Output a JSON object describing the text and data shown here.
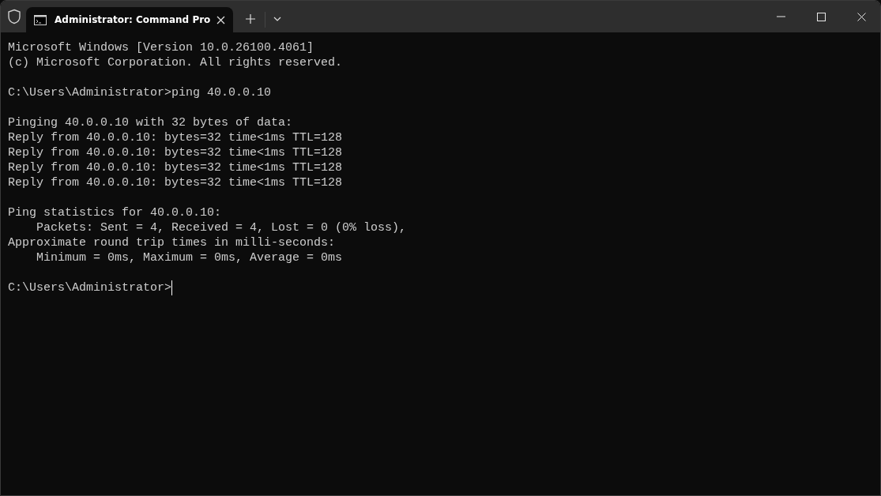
{
  "tabs": [
    {
      "title": "Administrator: Command Pro",
      "selected": true
    }
  ],
  "console": {
    "blocks": [
      [
        "Microsoft Windows [Version 10.0.26100.4061]",
        "(c) Microsoft Corporation. All rights reserved."
      ],
      [
        "C:\\Users\\Administrator>ping 40.0.0.10"
      ],
      [
        "Pinging 40.0.0.10 with 32 bytes of data:",
        "Reply from 40.0.0.10: bytes=32 time<1ms TTL=128",
        "Reply from 40.0.0.10: bytes=32 time<1ms TTL=128",
        "Reply from 40.0.0.10: bytes=32 time<1ms TTL=128",
        "Reply from 40.0.0.10: bytes=32 time<1ms TTL=128"
      ],
      [
        "Ping statistics for 40.0.0.10:",
        "    Packets: Sent = 4, Received = 4, Lost = 0 (0% loss),",
        "Approximate round trip times in milli-seconds:",
        "    Minimum = 0ms, Maximum = 0ms, Average = 0ms"
      ]
    ],
    "prompt": "C:\\Users\\Administrator>"
  }
}
